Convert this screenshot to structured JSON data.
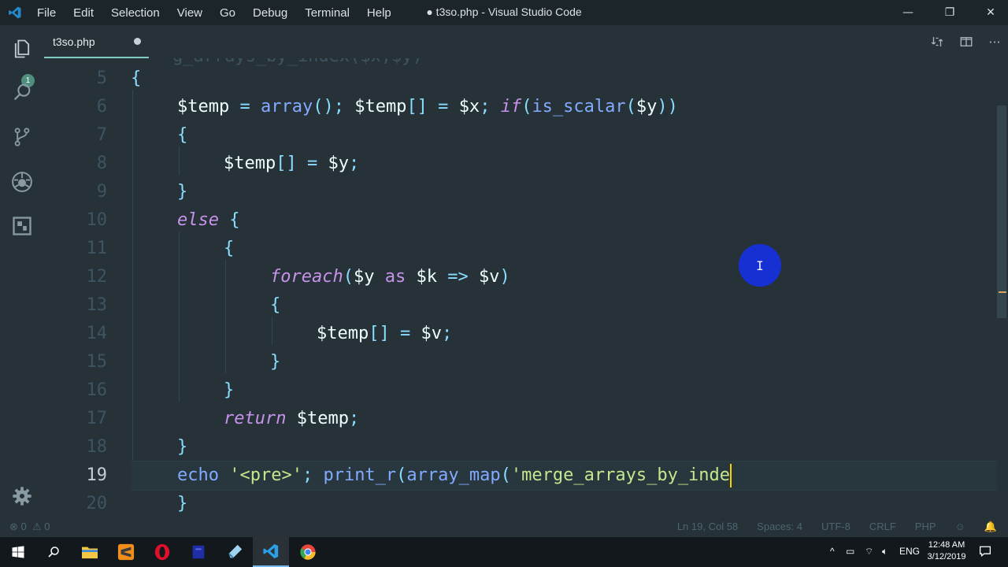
{
  "window": {
    "title": "● t3so.php - Visual Studio Code",
    "menu": [
      "File",
      "Edit",
      "Selection",
      "View",
      "Go",
      "Debug",
      "Terminal",
      "Help"
    ],
    "controls": {
      "minimize": "—",
      "restore": "❐",
      "close": "✕"
    }
  },
  "activity_bar": {
    "icons": [
      "files-icon",
      "search-icon",
      "source-control-icon",
      "debug-icon",
      "extensions-icon",
      "settings-gear-icon"
    ],
    "scm_badge": "1"
  },
  "tabs": [
    {
      "label": "t3so.php",
      "dirty": true
    }
  ],
  "editor": {
    "lines": [
      {
        "n": "5",
        "tokens": [
          [
            "p",
            "{"
          ]
        ]
      },
      {
        "n": "6",
        "tokens": [
          [
            "v",
            "$temp"
          ],
          [
            "o",
            " = "
          ],
          [
            "f",
            "array"
          ],
          [
            "p",
            "(); "
          ],
          [
            "v",
            "$temp"
          ],
          [
            "p",
            "[]"
          ],
          [
            "o",
            " = "
          ],
          [
            "v",
            "$x"
          ],
          [
            "p",
            "; "
          ],
          [
            "k",
            "if"
          ],
          [
            "p",
            "("
          ],
          [
            "f",
            "is_scalar"
          ],
          [
            "p",
            "("
          ],
          [
            "v",
            "$y"
          ],
          [
            "p",
            "))"
          ]
        ]
      },
      {
        "n": "7",
        "tokens": [
          [
            "p",
            "{"
          ]
        ]
      },
      {
        "n": "8",
        "tokens": [
          [
            "v",
            "$temp"
          ],
          [
            "p",
            "[]"
          ],
          [
            "o",
            " = "
          ],
          [
            "v",
            "$y"
          ],
          [
            "p",
            ";"
          ]
        ]
      },
      {
        "n": "9",
        "tokens": [
          [
            "p",
            "}"
          ]
        ]
      },
      {
        "n": "10",
        "tokens": [
          [
            "k",
            "else"
          ],
          [
            "p",
            " {"
          ]
        ]
      },
      {
        "n": "11",
        "tokens": [
          [
            "p",
            "{"
          ]
        ]
      },
      {
        "n": "12",
        "tokens": [
          [
            "k",
            "foreach"
          ],
          [
            "p",
            "("
          ],
          [
            "v",
            "$y"
          ],
          [
            "kn",
            " as "
          ],
          [
            "v",
            "$k"
          ],
          [
            "o",
            " => "
          ],
          [
            "v",
            "$v"
          ],
          [
            "p",
            ")"
          ]
        ]
      },
      {
        "n": "13",
        "tokens": [
          [
            "p",
            "{"
          ]
        ]
      },
      {
        "n": "14",
        "tokens": [
          [
            "v",
            "$temp"
          ],
          [
            "p",
            "[]"
          ],
          [
            "o",
            " = "
          ],
          [
            "v",
            "$v"
          ],
          [
            "p",
            ";"
          ]
        ]
      },
      {
        "n": "15",
        "tokens": [
          [
            "p",
            "}"
          ]
        ]
      },
      {
        "n": "16",
        "tokens": [
          [
            "p",
            "}"
          ]
        ]
      },
      {
        "n": "17",
        "tokens": [
          [
            "k",
            "return"
          ],
          [
            "v",
            " $temp"
          ],
          [
            "p",
            ";"
          ]
        ]
      },
      {
        "n": "18",
        "tokens": [
          [
            "p",
            "}"
          ]
        ]
      },
      {
        "n": "19",
        "tokens": [
          [
            "f",
            "echo"
          ],
          [
            "v",
            " "
          ],
          [
            "s",
            "'<pre>'"
          ],
          [
            "p",
            "; "
          ],
          [
            "f",
            "print_r"
          ],
          [
            "p",
            "("
          ],
          [
            "f",
            "array_map"
          ],
          [
            "p",
            "("
          ],
          [
            "s",
            "'merge_arrays_by_inde"
          ]
        ],
        "current": true
      },
      {
        "n": "20",
        "tokens": [
          [
            "p",
            "}"
          ]
        ]
      }
    ]
  },
  "status": {
    "errors": "0",
    "warnings": "0",
    "position": "Ln 19, Col 58",
    "spaces": "Spaces: 4",
    "encoding": "UTF-8",
    "eol": "CRLF",
    "language": "PHP"
  },
  "taskbar": {
    "apps": [
      "windows-start-icon",
      "search-icon",
      "file-explorer-icon",
      "sublime-icon",
      "opera-icon",
      "app-icon",
      "notepad-icon",
      "vscode-icon",
      "chrome-icon"
    ],
    "tray_lang": "ENG",
    "time": "12:48 AM",
    "date": "3/12/2019"
  },
  "colors": {
    "background": "#263238",
    "variable": "#eeffff",
    "operator": "#89ddff",
    "function": "#82aaff",
    "keyword": "#c792ea",
    "string": "#c3e88d",
    "cursor_highlight": "#1730d4"
  }
}
